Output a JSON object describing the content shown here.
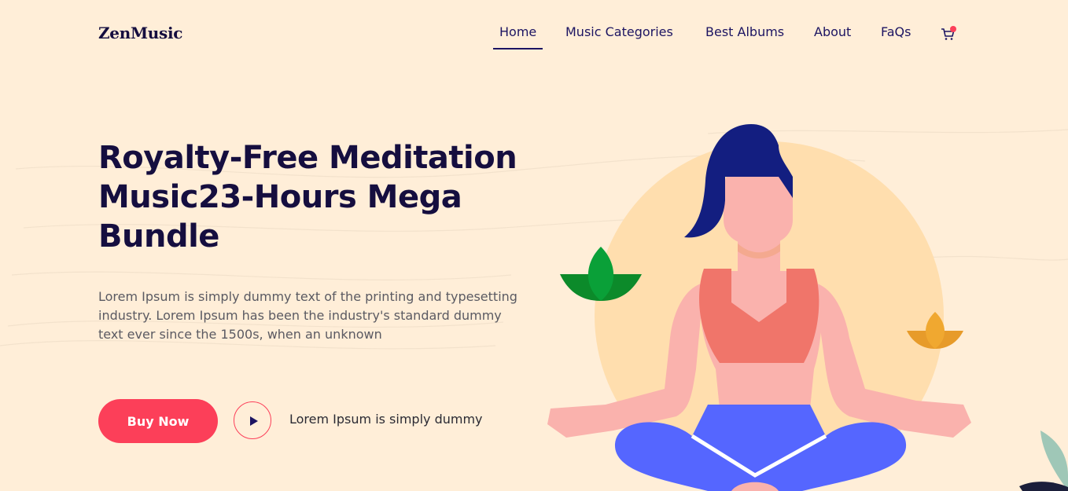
{
  "header": {
    "logo": "ZenMusic",
    "nav": [
      "Home",
      "Music Categories",
      "Best Albums",
      "About",
      "FaQs"
    ],
    "active_nav": "Home"
  },
  "hero": {
    "title": "Royalty-Free Meditation Music23-Hours Mega Bundle",
    "description": "Lorem Ipsum is simply dummy text of the printing and typesetting industry. Lorem Ipsum has been the industry's standard dummy text ever since the 1500s, when an unknown",
    "buy_label": "Buy Now",
    "play_text": "Lorem Ipsum is simply dummy"
  },
  "colors": {
    "background": "#ffeed8",
    "accent": "#fc3f59",
    "navy": "#150e3f"
  }
}
